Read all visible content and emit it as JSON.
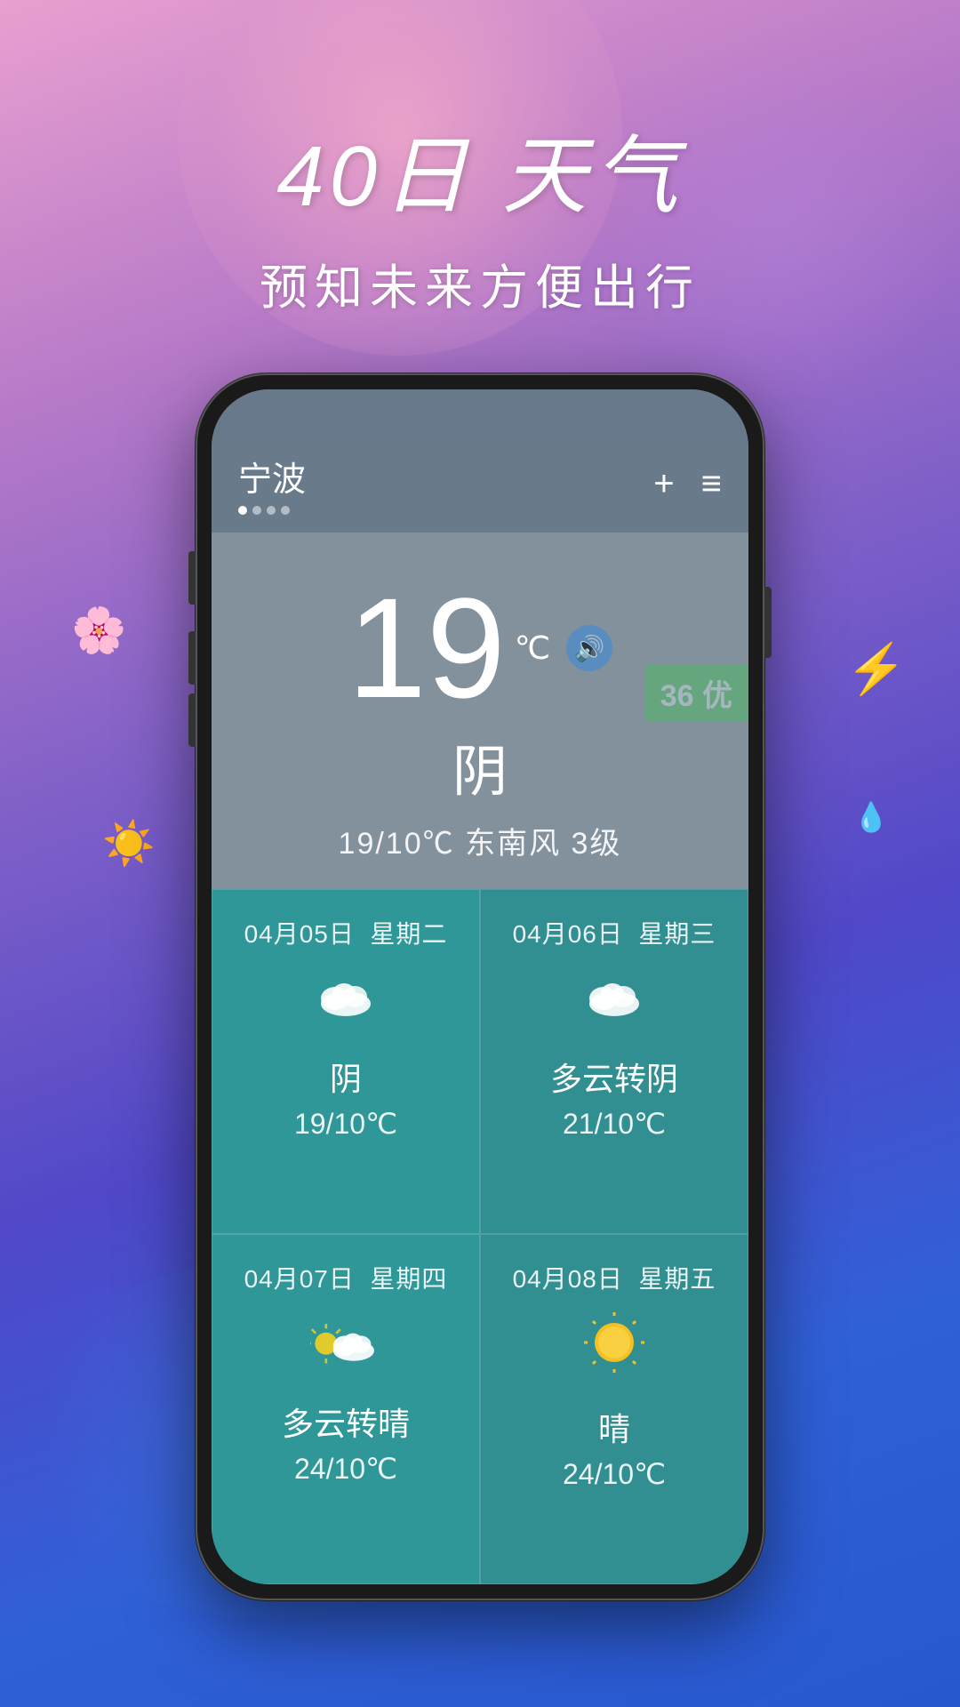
{
  "background": {
    "colors": [
      "#e8a0d0",
      "#b87ac8",
      "#8060c8",
      "#5048c8",
      "#3060d8",
      "#2858d0"
    ]
  },
  "title": {
    "main": "40日 天气",
    "sub": "预知未来方便出行"
  },
  "phone": {
    "header": {
      "city": "宁波",
      "plus_label": "+",
      "menu_label": "≡",
      "dots": [
        false,
        false,
        false,
        false
      ]
    },
    "aqi": {
      "value": "36",
      "label": "优",
      "badge_text": "36 优"
    },
    "current": {
      "temperature": "19",
      "unit": "℃",
      "condition": "阴",
      "detail": "19/10℃  东南风 3级"
    },
    "forecast": [
      {
        "date": "04月05日",
        "weekday": "星期二",
        "icon": "cloud",
        "condition": "阴",
        "temp": "19/10℃"
      },
      {
        "date": "04月06日",
        "weekday": "星期三",
        "icon": "cloud",
        "condition": "多云转阴",
        "temp": "21/10℃"
      },
      {
        "date": "04月07日",
        "weekday": "星期四",
        "icon": "cloud-sun",
        "condition": "多云转晴",
        "temp": "24/10℃"
      },
      {
        "date": "04月08日",
        "weekday": "星期五",
        "icon": "sun",
        "condition": "晴",
        "temp": "24/10℃"
      }
    ]
  }
}
